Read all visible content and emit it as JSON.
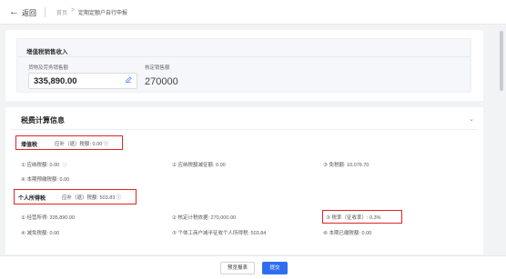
{
  "topbar": {
    "back_icon": "←",
    "back_label": "返回",
    "breadcrumb": {
      "home": "首页",
      "separator": ">",
      "current": "定期定额户自行申报"
    }
  },
  "vat_sales": {
    "title": "增值税销售收入",
    "goods_label": "货物及劳务销售额",
    "goods_value": "335,890.00",
    "edit_icon": "edit-icon",
    "assessed_label": "核定销售额",
    "assessed_value": "270000"
  },
  "tax_calc": {
    "title": "税费计算信息",
    "chevron": "⌄",
    "vat": {
      "header_title": "增值税",
      "header_amount": "应补（退）税额: 0.00 ⓘ",
      "items": [
        {
          "num": "①",
          "label": "应纳税额: 0.00",
          "info": "ⓘ"
        },
        {
          "num": "②",
          "label": "应纳税额减征额: 0.00",
          "info": ""
        },
        {
          "num": "③",
          "label": "免税额: 10,076.70",
          "info": ""
        },
        {
          "num": "④",
          "label": "本期预缴税额: 0.00",
          "info": ""
        }
      ]
    },
    "pit": {
      "header_title": "个人所得税",
      "header_amount": "应补（退）税额: 503.83 ⓘ",
      "items": [
        {
          "num": "①",
          "label": "经营所得: 335,890.00",
          "info": ""
        },
        {
          "num": "②",
          "label": "核定计税依据: 270,000.00",
          "info": ""
        },
        {
          "num": "③",
          "label": "税率（征收率）: 0.3%",
          "info": ""
        },
        {
          "num": "④",
          "label": "减免税额: 0.00",
          "info": ""
        },
        {
          "num": "⑤",
          "label": "个体工商户减半征收个人所得税: 503.84",
          "info": ""
        },
        {
          "num": "⑥",
          "label": "本期已缴税额: 0.00",
          "info": ""
        }
      ]
    }
  },
  "footer": {
    "preview_label": "预览报表",
    "submit_label": "提交"
  },
  "colors": {
    "accent": "#2f6ef0",
    "highlight_border": "#e02424",
    "background": "#f2f3f5"
  }
}
